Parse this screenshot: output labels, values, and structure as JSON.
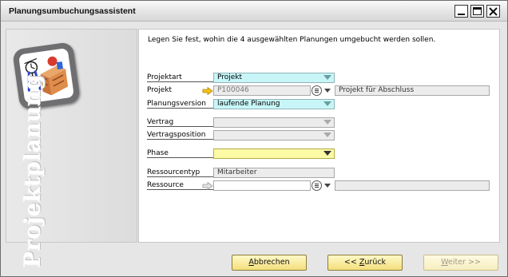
{
  "window": {
    "title": "Planungsumbuchungsassistent"
  },
  "sidebar": {
    "label": "Projektplanung"
  },
  "panel": {
    "intro": "Legen Sie fest, wohin die 4 ausgewählten Planungen umgebucht werden sollen."
  },
  "form": {
    "projektart": {
      "label": "Projektart",
      "value": "Projekt"
    },
    "projekt": {
      "label": "Projekt",
      "value": "P100046",
      "description": "Projekt für Abschluss"
    },
    "planungsversion": {
      "label": "Planungsversion",
      "value": "laufende Planung"
    },
    "vertrag": {
      "label": "Vertrag",
      "value": ""
    },
    "vertragsposition": {
      "label": "Vertragsposition",
      "value": ""
    },
    "phase": {
      "label": "Phase",
      "value": ""
    },
    "ressourcentyp": {
      "label": "Ressourcentyp",
      "value": "Mitarbeiter"
    },
    "ressource": {
      "label": "Ressource",
      "value": "",
      "description": ""
    }
  },
  "buttons": {
    "abbrechen": {
      "prefix": "",
      "mnemonic": "A",
      "rest": "bbrechen"
    },
    "zurueck": {
      "prefix": "<< ",
      "mnemonic": "Z",
      "rest": "urück"
    },
    "weiter": {
      "prefix": "",
      "mnemonic": "W",
      "rest": "eiter >>"
    }
  },
  "colors": {
    "button_gold": "#f3df7c",
    "required_cyan": "#c8f6f8",
    "mandatory_yellow": "#fdfaa6",
    "link_arrow": "#e8b400"
  }
}
